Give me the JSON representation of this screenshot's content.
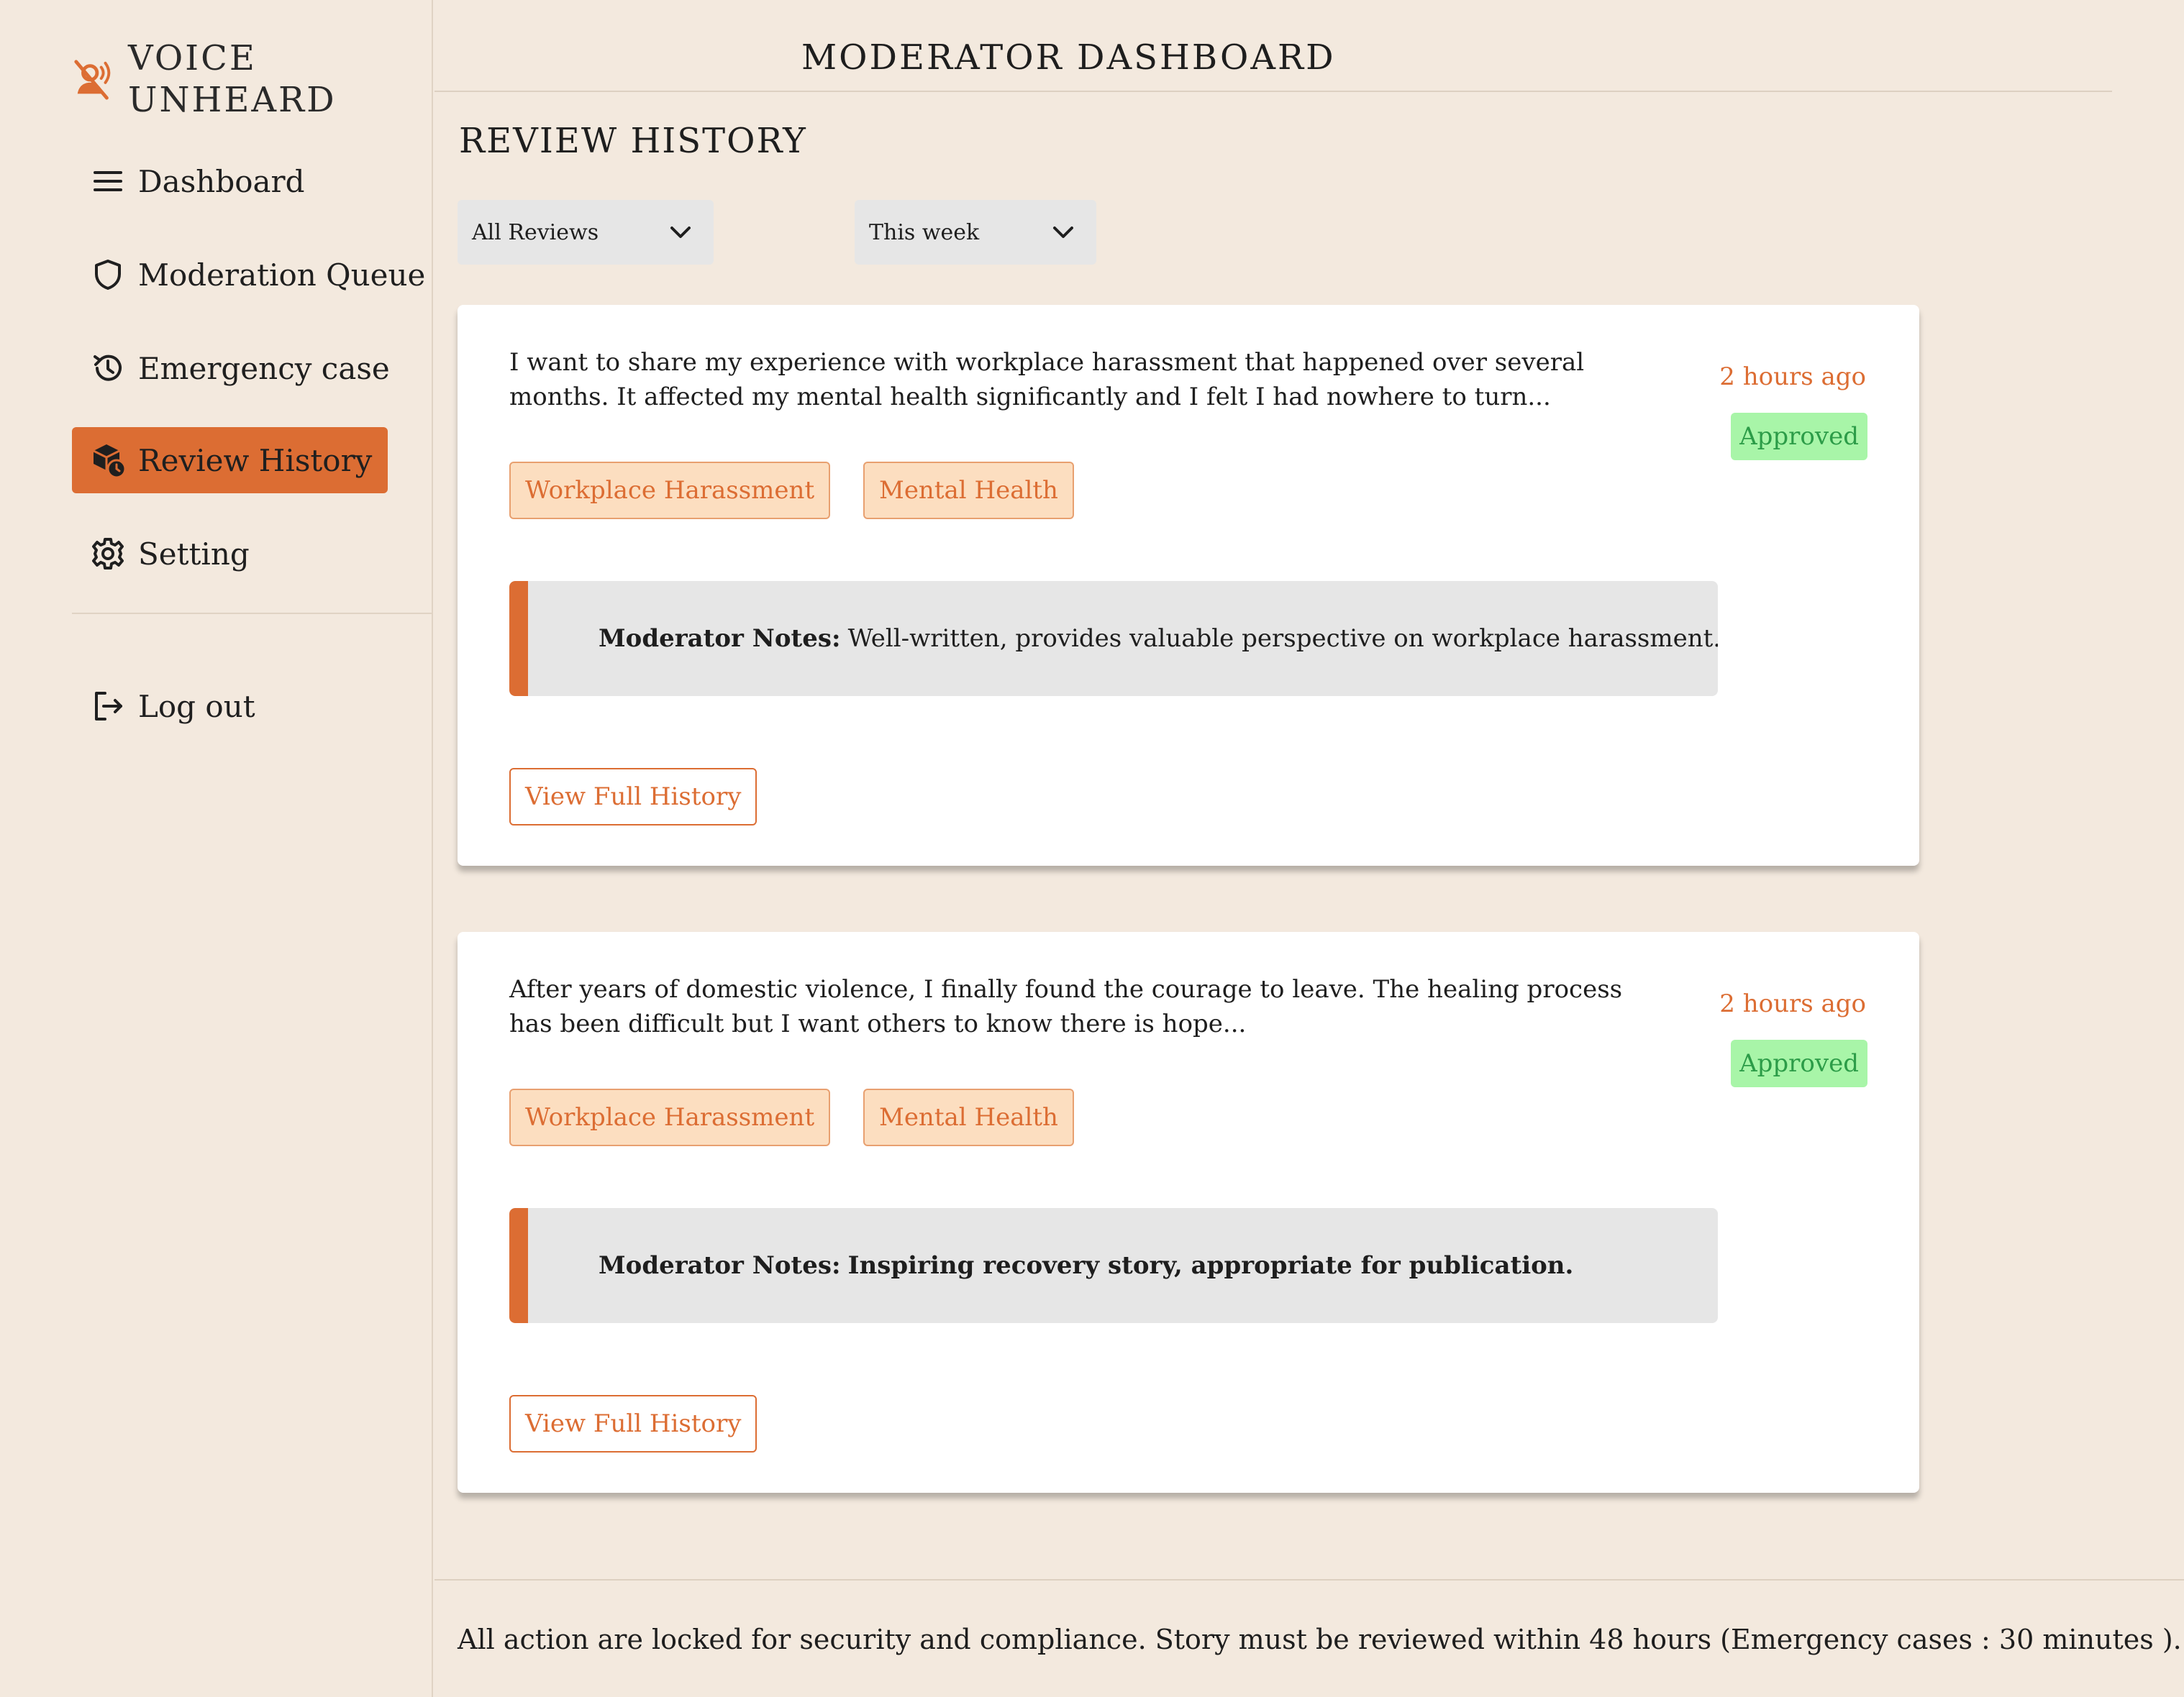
{
  "brand": {
    "name_line1": "VOICE",
    "name_line2": "UNHEARD",
    "icon": "voice-off-icon",
    "accent": "#dc6d33"
  },
  "nav": {
    "items": [
      {
        "label": "Dashboard",
        "icon": "menu-icon",
        "active": false
      },
      {
        "label": "Moderation Queue",
        "icon": "shield-icon",
        "active": false
      },
      {
        "label": "Emergency case",
        "icon": "history-icon",
        "active": false
      },
      {
        "label": "Review History",
        "icon": "package-clock-icon",
        "active": true
      },
      {
        "label": "Setting",
        "icon": "gear-icon",
        "active": false
      }
    ],
    "logout": {
      "label": "Log out",
      "icon": "logout-icon"
    }
  },
  "header": {
    "title": "MODERATOR DASHBOARD"
  },
  "section": {
    "title": "REVIEW HISTORY"
  },
  "filters": {
    "type": {
      "selected": "All Reviews"
    },
    "period": {
      "selected": "This week"
    }
  },
  "reviews": [
    {
      "text": "I want to share my experience with workplace harassment that happened over several months. It affected my mental health significantly and I felt I had nowhere to turn...",
      "time": "2 hours ago",
      "status": "Approved",
      "tags": [
        "Workplace Harassment",
        "Mental Health"
      ],
      "note_label": "Moderator Notes:",
      "note_text": "Well-written, provides valuable perspective on workplace harassment.",
      "button": "View Full History"
    },
    {
      "text": "After years of domestic violence, I finally found the courage to leave. The healing process has been difficult but I want others to know there is hope...",
      "time": "2 hours ago",
      "status": "Approved",
      "tags": [
        "Workplace Harassment",
        "Mental Health"
      ],
      "note_label": "Moderator Notes:",
      "note_text": "Inspiring recovery story, appropriate for publication.",
      "button": "View Full History"
    }
  ],
  "footer": {
    "text": "All action are locked for security and compliance. Story must be reviewed within 48 hours (Emergency cases : 30 minutes )."
  },
  "colors": {
    "accent": "#dc6d33",
    "approved_bg": "#a8f5a8",
    "approved_text": "#2c9c48",
    "tag_bg": "#fcdec0",
    "page_bg": "#f3e9de"
  }
}
